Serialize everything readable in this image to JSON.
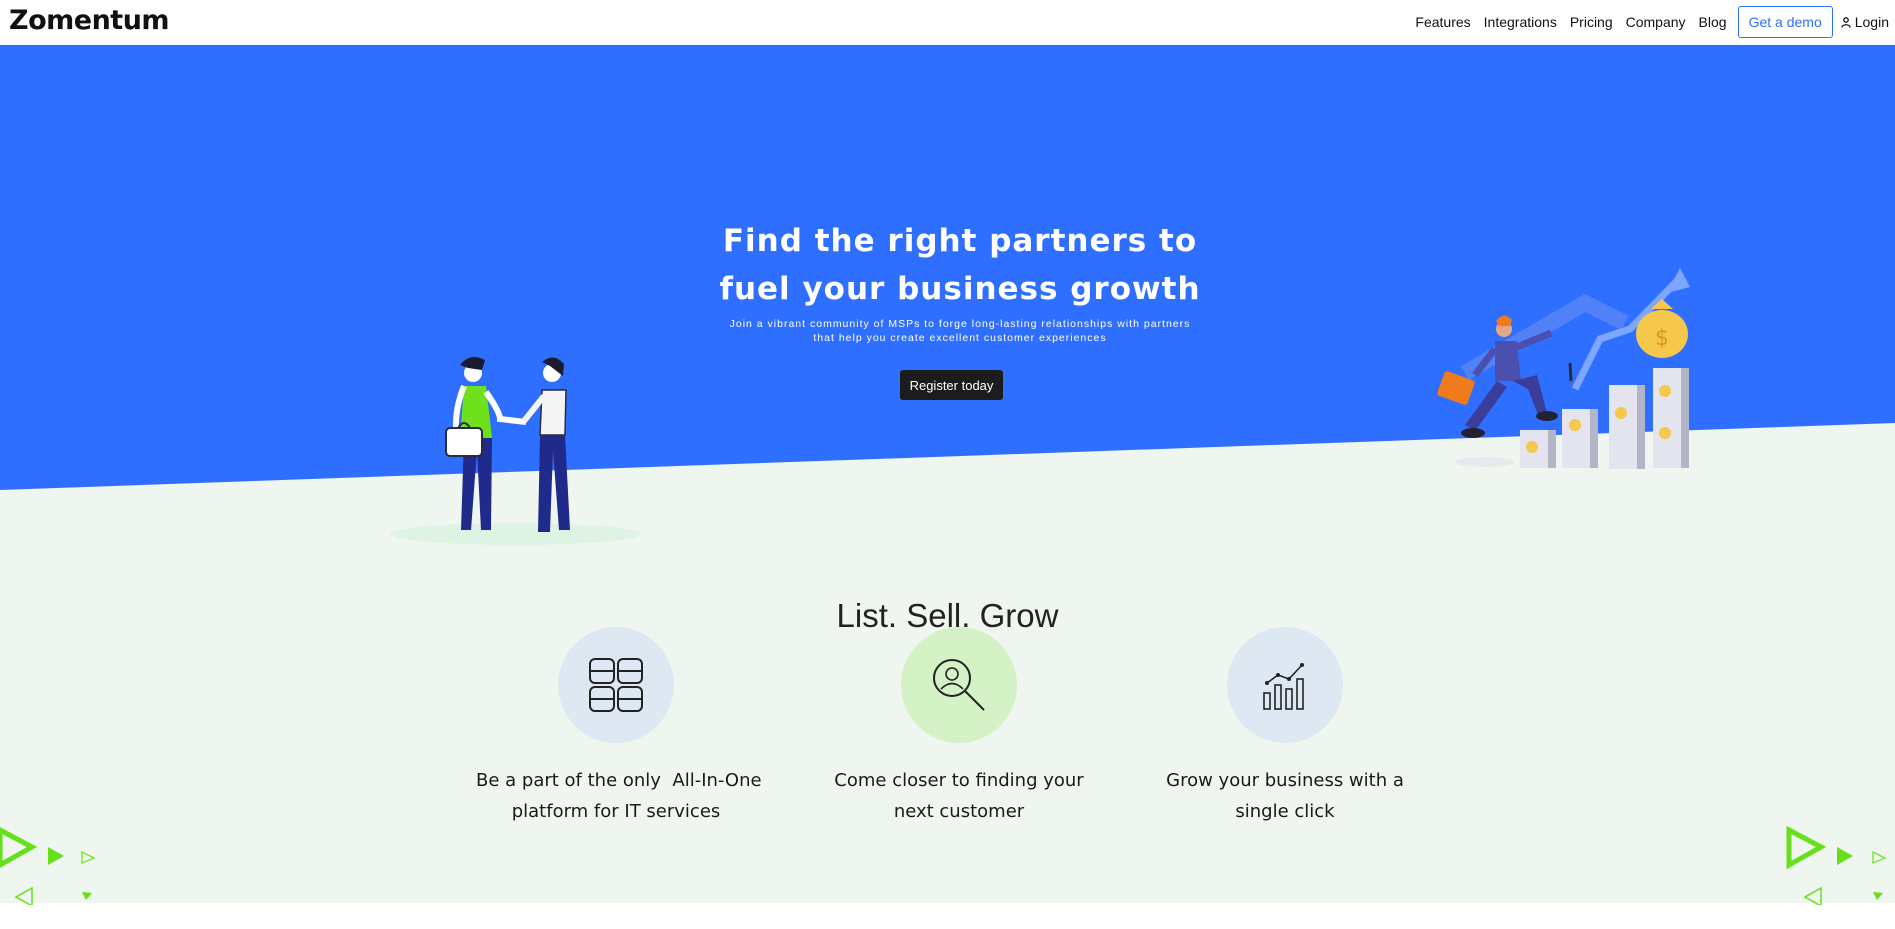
{
  "nav": {
    "logo": "Zomentum",
    "links": [
      "Features",
      "Integrations",
      "Pricing",
      "Company",
      "Blog"
    ],
    "demo_label": "Get a demo",
    "login_label": "Login"
  },
  "hero": {
    "title_line1": "Find the right partners to",
    "title_line2": "fuel your business growth",
    "subtitle_line1": "Join a vibrant community of MSPs to forge long-lasting relationships with partners",
    "subtitle_line2": "that help you create excellent customer experiences",
    "cta_label": "Register today"
  },
  "features": {
    "title": "List. Sell. Grow",
    "items": [
      {
        "icon": "grid-layout-icon",
        "line1": "Be a part of the only  All-In-One",
        "line2": "platform for IT services"
      },
      {
        "icon": "search-person-icon",
        "line1": "Come closer to finding your",
        "line2": "next customer"
      },
      {
        "icon": "growth-chart-icon",
        "line1": "Grow your business with a",
        "line2": "single click"
      }
    ]
  },
  "colors": {
    "hero_blue": "#2f6fff",
    "light_section": "#eff6f0",
    "accent_green": "#66e01a",
    "dark_button": "#1c1c1c"
  }
}
